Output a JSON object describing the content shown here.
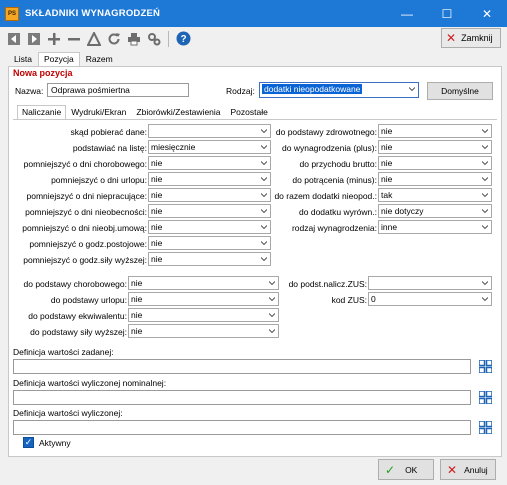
{
  "window": {
    "title": "SKŁADNIKI WYNAGRODZEŃ",
    "icon_text": "PS",
    "minimize_glyph": "—",
    "maximize_glyph": "☐",
    "close_glyph": "✕"
  },
  "toolbar": {
    "close_label": "Zamknij",
    "close_glyph": "✕",
    "help_glyph": "?"
  },
  "main_tabs": [
    "Lista",
    "Pozycja",
    "Razem"
  ],
  "form": {
    "section_title": "Nowa pozycja",
    "name_label": "Nazwa:",
    "name_value": "Odprawa pośmiertna",
    "kind_label": "Rodzaj:",
    "kind_value": "dodatki nieopodatkowane",
    "defaults_button": "Domyślne"
  },
  "sub_tabs": [
    "Naliczanie",
    "Wydruki/Ekran",
    "Zbiorówki/Zestawienia",
    "Pozostałe"
  ],
  "left_fields": [
    {
      "label": "skąd pobierać dane:",
      "value": ""
    },
    {
      "label": "podstawiać na listę:",
      "value": "miesięcznie"
    },
    {
      "label": "pomniejszyć o dni chorobowego:",
      "value": "nie"
    },
    {
      "label": "pomniejszyć o dni urlopu:",
      "value": "nie"
    },
    {
      "label": "pomniejszyć o dni niepracujące:",
      "value": "nie"
    },
    {
      "label": "pomniejszyć o dni nieobecności:",
      "value": "nie"
    },
    {
      "label": "pomniejszyć o dni nieobj.umową:",
      "value": "nie"
    },
    {
      "label": "pomniejszyć o godz.postojowe:",
      "value": "nie"
    },
    {
      "label": "pomniejszyć o godz.siły wyższej:",
      "value": "nie"
    }
  ],
  "right_fields": [
    {
      "label": "do podstawy zdrowotnego:",
      "value": "nie"
    },
    {
      "label": "do wynagrodzenia (plus):",
      "value": "nie"
    },
    {
      "label": "do przychodu brutto:",
      "value": "nie"
    },
    {
      "label": "do potrącenia (minus):",
      "value": "nie"
    },
    {
      "label": "do razem dodatki nieopod.:",
      "value": "tak"
    },
    {
      "label": "do dodatku wyrówn.:",
      "value": "nie dotyczy"
    },
    {
      "label": "rodzaj wynagrodzenia:",
      "value": "inne"
    }
  ],
  "lower_left_fields": [
    {
      "label": "do podstawy chorobowego:",
      "value": "nie"
    },
    {
      "label": "do podstawy urlopu:",
      "value": "nie"
    },
    {
      "label": "do podstawy ekwiwalentu:",
      "value": "nie"
    },
    {
      "label": "do podstawy siły wyższej:",
      "value": "nie"
    }
  ],
  "lower_right_fields": [
    {
      "label": "do podst.nalicz.ZUS:",
      "value": ""
    },
    {
      "label": "kod ZUS:",
      "value": "0"
    }
  ],
  "definitions": [
    {
      "label": "Definicja wartości zadanej:",
      "value": ""
    },
    {
      "label": "Definicja wartości wyliczonej nominalnej:",
      "value": ""
    },
    {
      "label": "Definicja wartości wyliczonej:",
      "value": ""
    }
  ],
  "active": {
    "label": "Aktywny",
    "checked": true,
    "check_glyph": "✓"
  },
  "buttons": {
    "ok": "OK",
    "ok_glyph": "✓",
    "cancel": "Anuluj",
    "cancel_glyph": "✕"
  },
  "colors": {
    "titlebar": "#1e78d6",
    "section_title": "#c00000",
    "ok_check": "#1f9e1f",
    "cancel_x": "#d01c1c",
    "selection": "#0a64d6"
  }
}
